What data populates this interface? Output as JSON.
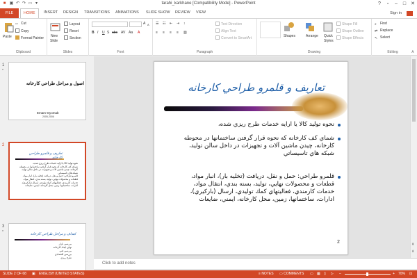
{
  "window": {
    "title": "tarahi_karkhane [Compatibility Mode] - PowerPoint",
    "signin": "Sign in"
  },
  "tabs": [
    "FILE",
    "HOME",
    "INSERT",
    "DESIGN",
    "TRANSITIONS",
    "ANIMATIONS",
    "SLIDE SHOW",
    "REVIEW",
    "VIEW"
  ],
  "ribbon": {
    "clipboard": {
      "paste": "Paste",
      "cut": "Cut",
      "copy": "Copy",
      "format_painter": "Format Painter",
      "label": "Clipboard"
    },
    "slides": {
      "new_slide": "New",
      "new_slide2": "Slide",
      "layout": "Layout",
      "reset": "Reset",
      "section": "Section",
      "label": "Slides"
    },
    "font": {
      "label": "Font"
    },
    "paragraph": {
      "text_direction": "Text Direction",
      "align_text": "Align Text",
      "smartart": "Convert to SmartArt",
      "label": "Paragraph"
    },
    "drawing": {
      "shapes": "Shapes",
      "arrange": "Arrange",
      "quick": "Quick",
      "styles": "Styles",
      "shape_fill": "Shape Fill",
      "shape_outline": "Shape Outline",
      "shape_effects": "Shape Effects",
      "label": "Drawing"
    },
    "editing": {
      "find": "Find",
      "replace": "Replace",
      "select": "Select",
      "label": "Editing"
    }
  },
  "thumbnails": [
    {
      "num": "1",
      "title": "اصول و مراحل طراحي كارخانه",
      "author": "Emam-Oyomab",
      "sub": "2005-2006"
    },
    {
      "num": "2",
      "title": "تعاريف و قلمرو طراحي كارخانه",
      "lines": [
        "نحوه توليد كالا يا ارايه خدمات طرح ريزي شده،",
        "شماي كف كارخانه كه نحوه قرار گرفتن ساختمانها در محوطه",
        "كارخانه، چيدن ماشين آلات و تجهيزات در داخل سالن توليد،",
        "شبكه هاي تاسيساتي",
        "قلمرو طراحي: حمل و نقل، دريافت (تخليه بار)، انبار مواد،",
        "قطعات و محصولات نهايي، توليد، بسته بندي، انتقال مواد،",
        "خدمات كارمندي، فعاليتهاي كمك توليدي، ارسال (باركيري)،",
        "ادارات، ساختمانها، زمين، محل كارخانه، ايمني، ضايعات"
      ]
    },
    {
      "num": "3",
      "title": "اهداف و مراحل طراحي كارخانه",
      "lines": [
        "بررسي بازار",
        "تهاي ايجاد كارخانه",
        "بررسي فني",
        "بررسي اقتصادي",
        "طرح ريزي"
      ]
    }
  ],
  "slide": {
    "title": "تعاريف و قلمرو طراحي كارخانه",
    "bullets": [
      [
        "نحوه توليد كالا يا ارايه خدمات طرح  ريزي شده،"
      ],
      [
        "شماي كف كارخانه كه نحوه قرار گرفتن ساختمانها در محوطه",
        "كارخانه، چيدن ماشين آلات و تجهيزات در داخل سالن توليد،",
        "شبكه هاي تاسيساتي"
      ],
      [
        "قلمرو طراحي: حمل و نقل، دريافت (تخليه بار)، انبار مواد،",
        "قطعات و محصولات نهايي، توليد، بسته بندي، انتقال مواد،",
        "خدمات كارمندي، فعاليتهاي كمك توليدي، ارسال (باركيري)،",
        "ادارات، ساختمانها، زمين، محل كارخانه، ايمني، ضايعات"
      ]
    ],
    "page_number": "2"
  },
  "notes_placeholder": "Click to add notes",
  "status": {
    "slide_of": "SLIDE 2 OF 68",
    "language": "ENGLISH (UNITED STATES)",
    "notes": "NOTES",
    "comments": "COMMENTS",
    "zoom": "70%"
  },
  "colors": {
    "accent": "#d24726",
    "title_blue": "#1f5fa8"
  }
}
